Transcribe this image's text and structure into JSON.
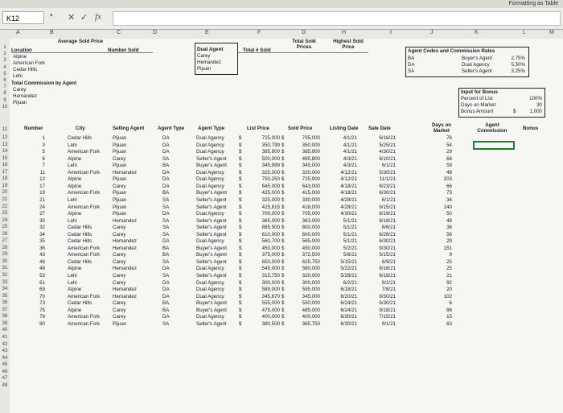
{
  "app": {
    "ribbon_title": "Formatting as Table"
  },
  "formula_bar": {
    "name_box": "K12",
    "cancel": "✕",
    "confirm": "✓",
    "fx": "fx",
    "value": ""
  },
  "columns": [
    "A",
    "B",
    "C",
    "D",
    "E",
    "F",
    "G",
    "H",
    "I",
    "J",
    "K",
    "L",
    "M"
  ],
  "rows": [
    "1",
    "2",
    "3",
    "4",
    "5",
    "6",
    "7",
    "8",
    "9",
    "10",
    "11",
    "12",
    "13",
    "14",
    "15",
    "16",
    "17",
    "18",
    "19",
    "20",
    "21",
    "22",
    "23",
    "24",
    "25",
    "26",
    "27",
    "28",
    "29",
    "30",
    "31",
    "32",
    "33",
    "34",
    "35",
    "36",
    "37",
    "38",
    "39",
    "40",
    "41",
    "42",
    "43",
    "44",
    "45",
    "46",
    "47",
    "48"
  ],
  "top_section": {
    "location_header": "Location",
    "avg_price_header": "Average Sold Price",
    "number_sold_header": "Number Sold",
    "locations": [
      "Alpine",
      "American Fork",
      "Cedar Hills",
      "Lehi"
    ],
    "total_commission": "Total Commission by Agent",
    "agents": [
      "Carey",
      "Hemandez",
      "Pijuan"
    ],
    "dual_agent_header": "Dual Agent",
    "dual_agents": [
      "Carey",
      "Hemandez",
      "Pijuan"
    ],
    "total_sold_header": "Total # Sold",
    "total_sold_prices_header": "Total Sold Prices",
    "highest_sold_header": "Highest Sold Price"
  },
  "rates": {
    "title": "Agent Codes and Commission Rates",
    "rows": [
      {
        "code": "BA",
        "label": "Buyer's Agent",
        "rate": "2.75%"
      },
      {
        "code": "DA",
        "label": "Dual Agency",
        "rate": "5.50%"
      },
      {
        "code": "SA",
        "label": "Seller's Agent",
        "rate": "3.25%"
      }
    ]
  },
  "bonus_input": {
    "title": "Input for Bonus",
    "rows": [
      {
        "label": "Percent of List",
        "value": "100%"
      },
      {
        "label": "Days on Market",
        "value": "30"
      },
      {
        "label": "Bonus Amount",
        "currency": "$",
        "value": "1,000"
      }
    ]
  },
  "table": {
    "headers": {
      "number": "Number",
      "city": "City",
      "selling_agent": "Selling Agent",
      "agent_type": "Agent Type",
      "agent_type2": "Agent Type",
      "list_price": "List Price",
      "sold_price": "Sold Price",
      "listing_date": "Listing Date",
      "sale_date": "Sale Date",
      "days_on_market": "Days on Market",
      "agent_commission": "Agent Commission",
      "bonus": "Bonus"
    },
    "rows": [
      {
        "n": "1",
        "city": "Cedar Hills",
        "agent": "Pijuan",
        "code": "DA",
        "type": "Dual Agency",
        "list": "725,000",
        "sold": "705,000",
        "ld": "4/1/21",
        "sd": "6/16/21",
        "dom": "76"
      },
      {
        "n": "3",
        "city": "Lehi",
        "agent": "Pijuan",
        "code": "DA",
        "type": "Dual Agency",
        "list": "350,799",
        "sold": "350,000",
        "ld": "4/1/21",
        "sd": "5/25/21",
        "dom": "54"
      },
      {
        "n": "5",
        "city": "American Fork",
        "agent": "Pijuan",
        "code": "DA",
        "type": "Dual Agency",
        "list": "385,900",
        "sold": "385,900",
        "ld": "4/1/21",
        "sd": "4/30/21",
        "dom": "29"
      },
      {
        "n": "6",
        "city": "Alpine",
        "agent": "Carey",
        "code": "SA",
        "type": "Seller's Agent",
        "list": "500,000",
        "sold": "495,800",
        "ld": "4/3/21",
        "sd": "6/10/21",
        "dom": "68"
      },
      {
        "n": "7",
        "city": "Lehi",
        "agent": "Pijuan",
        "code": "BA",
        "type": "Buyer's Agent",
        "list": "345,999",
        "sold": "345,000",
        "ld": "4/3/21",
        "sd": "6/1/21",
        "dom": "59"
      },
      {
        "n": "11",
        "city": "American Fork",
        "agent": "Hemandez",
        "code": "DA",
        "type": "Dual Agency",
        "list": "325,000",
        "sold": "320,000",
        "ld": "4/12/21",
        "sd": "5/30/21",
        "dom": "48"
      },
      {
        "n": "12",
        "city": "Alpine",
        "agent": "Pijuan",
        "code": "DA",
        "type": "Dual Agency",
        "list": "750,250",
        "sold": "725,900",
        "ld": "4/12/21",
        "sd": "11/1/21",
        "dom": "203"
      },
      {
        "n": "17",
        "city": "Alpine",
        "agent": "Carey",
        "code": "DA",
        "type": "Dual Agency",
        "list": "645,000",
        "sold": "643,000",
        "ld": "4/18/21",
        "sd": "6/23/21",
        "dom": "66"
      },
      {
        "n": "19",
        "city": "American Fork",
        "agent": "Pijuan",
        "code": "BA",
        "type": "Buyer's Agent",
        "list": "425,000",
        "sold": "415,000",
        "ld": "4/18/21",
        "sd": "6/30/21",
        "dom": "73"
      },
      {
        "n": "21",
        "city": "Lehi",
        "agent": "Pijuan",
        "code": "SA",
        "type": "Seller's Agent",
        "list": "325,000",
        "sold": "330,000",
        "ld": "4/28/21",
        "sd": "6/1/21",
        "dom": "34"
      },
      {
        "n": "24",
        "city": "American Fork",
        "agent": "Pijuan",
        "code": "SA",
        "type": "Seller's Agent",
        "list": "425,815",
        "sold": "418,000",
        "ld": "4/28/21",
        "sd": "9/15/21",
        "dom": "140"
      },
      {
        "n": "27",
        "city": "Alpine",
        "agent": "Pijuan",
        "code": "DA",
        "type": "Dual Agency",
        "list": "700,000",
        "sold": "705,000",
        "ld": "4/30/21",
        "sd": "6/19/21",
        "dom": "50"
      },
      {
        "n": "30",
        "city": "Lehi",
        "agent": "Hemandez",
        "code": "SA",
        "type": "Seller's Agent",
        "list": "365,000",
        "sold": "363,000",
        "ld": "5/1/21",
        "sd": "6/18/21",
        "dom": "48"
      },
      {
        "n": "32",
        "city": "Cedar Hills",
        "agent": "Carey",
        "code": "SA",
        "type": "Seller's Agent",
        "list": "885,500",
        "sold": "800,000",
        "ld": "5/1/21",
        "sd": "6/6/21",
        "dom": "36"
      },
      {
        "n": "34",
        "city": "Cedar Hills",
        "agent": "Carey",
        "code": "SA",
        "type": "Seller's Agent",
        "list": "610,000",
        "sold": "600,000",
        "ld": "5/1/21",
        "sd": "6/26/21",
        "dom": "56"
      },
      {
        "n": "35",
        "city": "Cedar Hills",
        "agent": "Hemandez",
        "code": "DA",
        "type": "Dual Agency",
        "list": "560,700",
        "sold": "565,000",
        "ld": "5/1/21",
        "sd": "6/30/21",
        "dom": "29"
      },
      {
        "n": "36",
        "city": "American Fork",
        "agent": "Hemandez",
        "code": "BA",
        "type": "Buyer's Agent",
        "list": "450,000",
        "sold": "450,000",
        "ld": "5/2/21",
        "sd": "9/30/21",
        "dom": "151"
      },
      {
        "n": "43",
        "city": "American Fork",
        "agent": "Carey",
        "code": "BA",
        "type": "Buyer's Agent",
        "list": "375,000",
        "sold": "372,500",
        "ld": "5/6/21",
        "sd": "5/15/21",
        "dom": "9"
      },
      {
        "n": "46",
        "city": "Cedar Hills",
        "agent": "Carey",
        "code": "SA",
        "type": "Seller's Agent",
        "list": "650,000",
        "sold": "625,750",
        "ld": "5/15/21",
        "sd": "6/9/21",
        "dom": "25"
      },
      {
        "n": "48",
        "city": "Alpine",
        "agent": "Hemandez",
        "code": "DA",
        "type": "Dual Agency",
        "list": "545,000",
        "sold": "560,000",
        "ld": "5/22/21",
        "sd": "6/16/21",
        "dom": "25"
      },
      {
        "n": "53",
        "city": "Lehi",
        "agent": "Carey",
        "code": "SA",
        "type": "Seller's Agent",
        "list": "315,750",
        "sold": "320,000",
        "ld": "5/28/21",
        "sd": "6/18/21",
        "dom": "21"
      },
      {
        "n": "61",
        "city": "Lehi",
        "agent": "Carey",
        "code": "DA",
        "type": "Dual Agency",
        "list": "300,000",
        "sold": "300,000",
        "ld": "6/2/21",
        "sd": "9/2/21",
        "dom": "92"
      },
      {
        "n": "69",
        "city": "Alpine",
        "agent": "Hemandez",
        "code": "DA",
        "type": "Dual Agency",
        "list": "589,000",
        "sold": "595,000",
        "ld": "6/18/21",
        "sd": "7/8/21",
        "dom": "20"
      },
      {
        "n": "70",
        "city": "American Fork",
        "agent": "Hemandez",
        "code": "DA",
        "type": "Dual Agency",
        "list": "345,670",
        "sold": "345,000",
        "ld": "6/20/21",
        "sd": "9/30/21",
        "dom": "102"
      },
      {
        "n": "73",
        "city": "Cedar Hills",
        "agent": "Carey",
        "code": "BA",
        "type": "Buyer's Agent",
        "list": "555,000",
        "sold": "550,000",
        "ld": "6/24/21",
        "sd": "6/30/21",
        "dom": "6"
      },
      {
        "n": "75",
        "city": "Alpine",
        "agent": "Carey",
        "code": "BA",
        "type": "Buyer's Agent",
        "list": "475,000",
        "sold": "485,000",
        "ld": "6/24/21",
        "sd": "9/18/21",
        "dom": "86"
      },
      {
        "n": "78",
        "city": "American Fork",
        "agent": "Carey",
        "code": "DA",
        "type": "Dual Agency",
        "list": "400,000",
        "sold": "400,000",
        "ld": "6/30/21",
        "sd": "7/15/21",
        "dom": "15"
      },
      {
        "n": "80",
        "city": "American Fork",
        "agent": "Pijuan",
        "code": "SA",
        "type": "Seller's Agent",
        "list": "380,500",
        "sold": "365,750",
        "ld": "6/30/21",
        "sd": "9/1/21",
        "dom": "63"
      }
    ]
  }
}
